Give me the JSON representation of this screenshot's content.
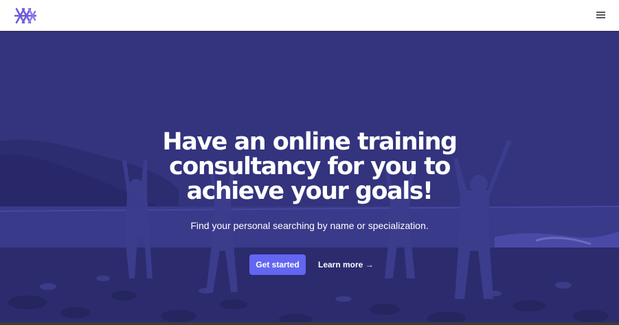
{
  "header": {
    "logo_icon": "brand-logo-icon",
    "menu_icon": "hamburger-menu-icon",
    "accent_color": "#6366f1"
  },
  "hero": {
    "headline": "Have an online training consultancy for you to achieve your goals!",
    "subheadline": "Find your personal searching by name or specialization.",
    "primary_cta": "Get started",
    "secondary_cta": "Learn more →",
    "background_description": "group-yoga-on-beach"
  }
}
